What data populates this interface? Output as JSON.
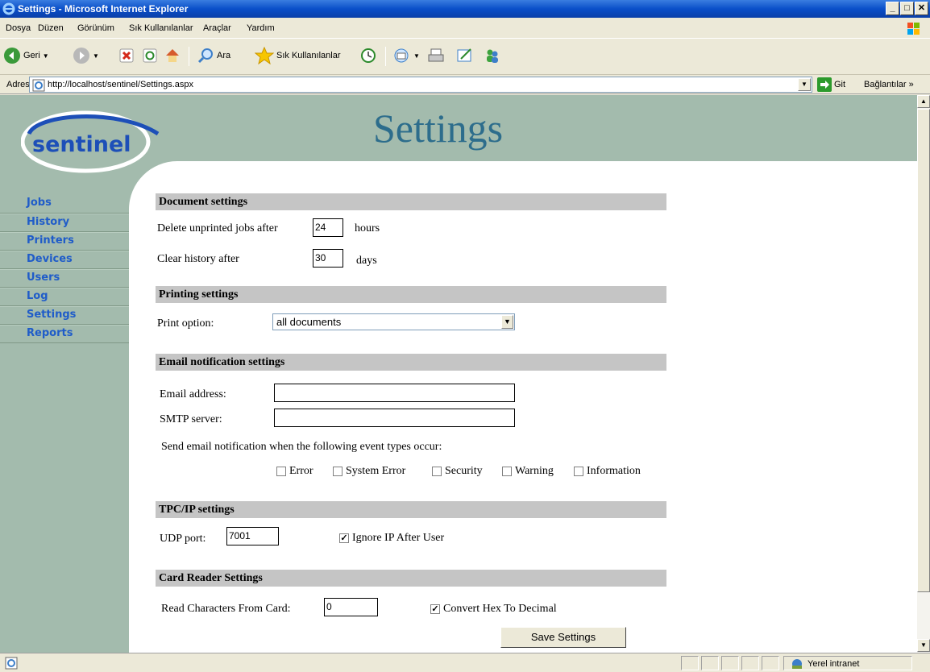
{
  "window": {
    "title": "Settings - Microsoft Internet Explorer",
    "buttons": [
      "_",
      "□",
      "✕"
    ]
  },
  "menu": [
    "Dosya",
    "Düzen",
    "Görünüm",
    "Sık Kullanılanlar",
    "Araçlar",
    "Yardım"
  ],
  "toolbar": {
    "back": "Geri",
    "search": "Ara",
    "favorites": "Sık Kullanılanlar"
  },
  "address": {
    "label": "Adres",
    "url": "http://localhost/sentinel/Settings.aspx",
    "go": "Git",
    "links": "Bağlantılar"
  },
  "page": {
    "logo": "sentinel",
    "title": "Settings"
  },
  "nav": [
    "Jobs",
    "History",
    "Printers",
    "Devices",
    "Users",
    "Log",
    "Settings",
    "Reports"
  ],
  "document_settings": {
    "header": "Document settings",
    "delete_label": "Delete unprinted jobs after",
    "delete_value": "24",
    "delete_unit": "hours",
    "clear_label": "Clear history after",
    "clear_value": "30",
    "clear_unit": "days"
  },
  "printing_settings": {
    "header": "Printing settings",
    "print_option_label": "Print option:",
    "print_option_value": "all documents"
  },
  "email_settings": {
    "header": "Email notification settings",
    "email_label": "Email address:",
    "email_value": "",
    "smtp_label": "SMTP server:",
    "smtp_value": "",
    "notify_label": "Send email notification when the following event types occur:",
    "events": [
      {
        "label": "Error",
        "checked": false
      },
      {
        "label": "System Error",
        "checked": false
      },
      {
        "label": "Security",
        "checked": false
      },
      {
        "label": "Warning",
        "checked": false
      },
      {
        "label": "Information",
        "checked": false
      }
    ]
  },
  "tcpip_settings": {
    "header": "TPC/IP settings",
    "udp_label": "UDP port:",
    "udp_value": "7001",
    "ignore_ip_label": "Ignore IP After User",
    "ignore_ip_checked": true
  },
  "card_reader_settings": {
    "header": "Card Reader Settings",
    "read_label": "Read Characters From Card:",
    "read_value": "0",
    "convert_label": "Convert Hex To Decimal",
    "convert_checked": true
  },
  "save_button": "Save Settings",
  "status": {
    "zone": "Yerel intranet"
  }
}
